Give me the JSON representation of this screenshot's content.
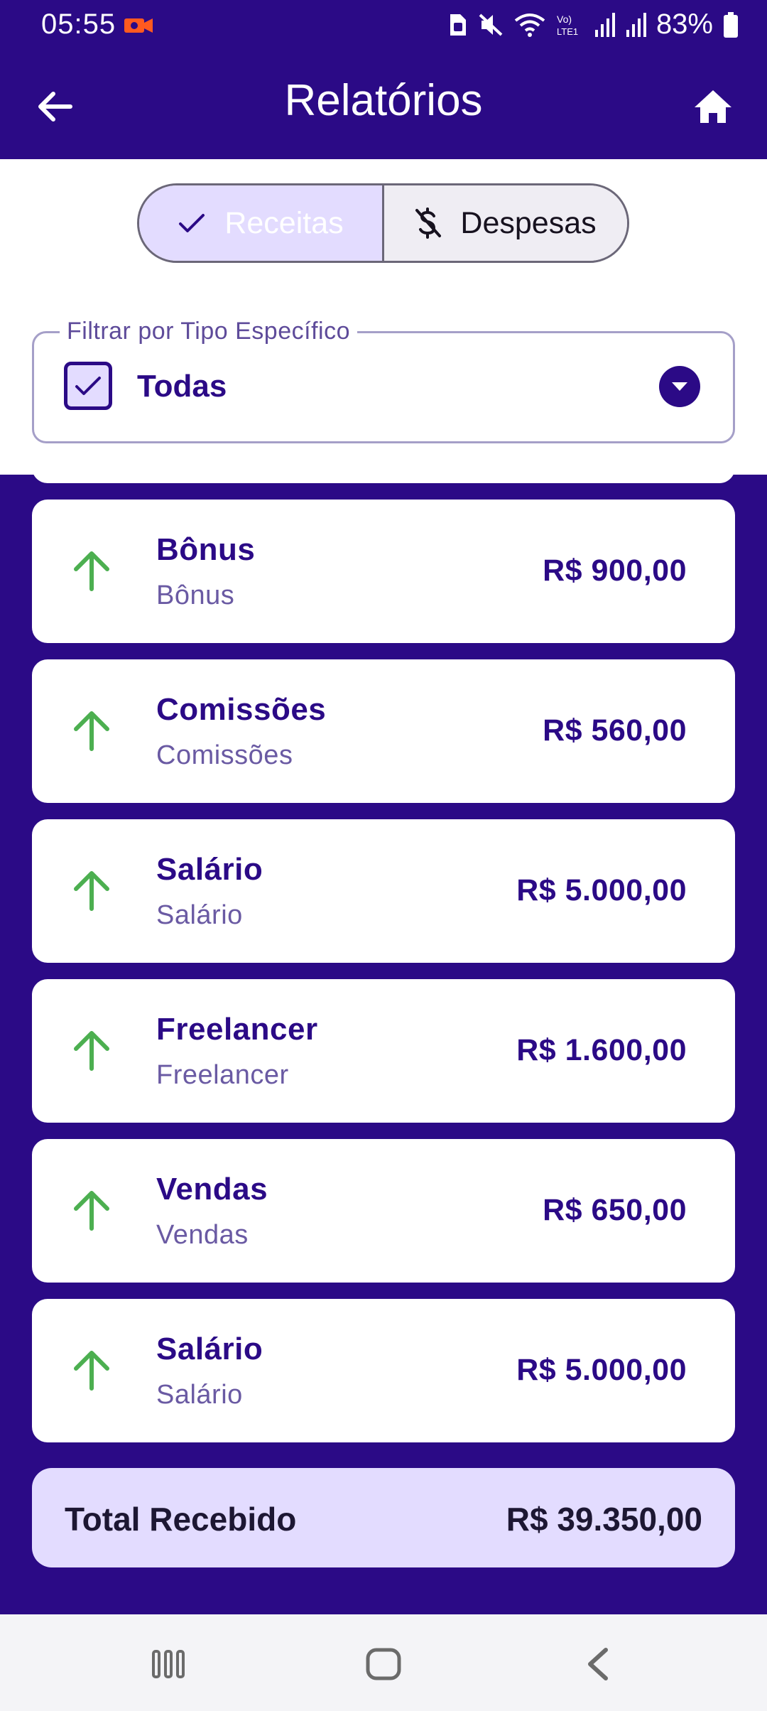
{
  "status_bar": {
    "time": "05:55",
    "battery": "83%"
  },
  "app_bar": {
    "title": "Relatórios"
  },
  "segmented": {
    "left_label": "Receitas",
    "right_label": "Despesas"
  },
  "filter": {
    "label": "Filtrar por Tipo Específico",
    "value": "Todas"
  },
  "items": [
    {
      "title": "Bônus",
      "subtitle": "Bônus",
      "amount": "R$ 900,00"
    },
    {
      "title": "Comissões",
      "subtitle": "Comissões",
      "amount": "R$ 560,00"
    },
    {
      "title": "Salário",
      "subtitle": "Salário",
      "amount": "R$ 5.000,00"
    },
    {
      "title": "Freelancer",
      "subtitle": "Freelancer",
      "amount": "R$ 1.600,00"
    },
    {
      "title": "Vendas",
      "subtitle": "Vendas",
      "amount": "R$ 650,00"
    },
    {
      "title": "Salário",
      "subtitle": "Salário",
      "amount": "R$ 5.000,00"
    }
  ],
  "total": {
    "label": "Total Recebido",
    "value": "R$ 39.350,00"
  },
  "colors": {
    "primary": "#2b0a86",
    "accent_light": "#e3dcff",
    "income_arrow": "#4caf50"
  },
  "icons": {
    "back": "arrow-left-icon",
    "home": "home-icon",
    "check": "check-icon",
    "money_off": "money-off-icon",
    "dropdown": "chevron-down-icon",
    "income": "arrow-up-icon"
  }
}
